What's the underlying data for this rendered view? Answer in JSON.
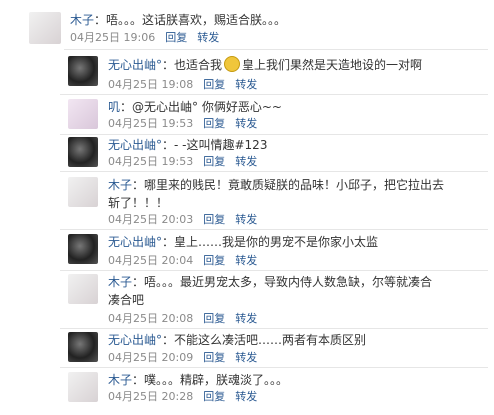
{
  "comments": [
    {
      "name": "木子",
      "avatar": "muzi-avatar",
      "text": "：唔。。。这话朕喜欢，赐适合朕。。。",
      "time": "04月25日 19:06",
      "reply": "回复",
      "forward": "转发"
    },
    {
      "name": "无心出岫°",
      "avatar": "wuxin-avatar",
      "text_before": "：也适合我",
      "emoji": "smiley-icon",
      "text_after": "皇上我们果然是天造地设的一对啊",
      "time": "04月25日 19:08",
      "reply": "回复",
      "forward": "转发"
    },
    {
      "name": "叽",
      "avatar": "ji-avatar",
      "text": "：@无心出岫° 你俩好恶心~~",
      "time": "04月25日 19:53",
      "reply": "回复",
      "forward": "转发"
    },
    {
      "name": "无心出岫°",
      "avatar": "wuxin-avatar",
      "text": "：- -这叫情趣#123",
      "time": "04月25日 19:53",
      "reply": "回复",
      "forward": "转发"
    },
    {
      "name": "木子",
      "avatar": "muzi-avatar",
      "text_line1": "：哪里来的贱民！竟敢质疑朕的品味！小邱子，把它拉出去",
      "text_line2": "斩了！！！",
      "time": "04月25日 20:03",
      "reply": "回复",
      "forward": "转发"
    },
    {
      "name": "无心出岫°",
      "avatar": "wuxin-avatar",
      "text": "：皇上……我是你的男宠不是你家小太监",
      "time": "04月25日 20:04",
      "reply": "回复",
      "forward": "转发"
    },
    {
      "name": "木子",
      "avatar": "muzi-avatar",
      "text_line1": "：唔。。。最近男宠太多，导致内侍人数急缺，尔等就凑合",
      "text_line2": "凑合吧",
      "time": "04月25日 20:08",
      "reply": "回复",
      "forward": "转发"
    },
    {
      "name": "无心出岫°",
      "avatar": "wuxin-avatar",
      "text": "：不能这么凑活吧……两者有本质区别",
      "time": "04月25日 20:09",
      "reply": "回复",
      "forward": "转发"
    },
    {
      "name": "木子",
      "avatar": "muzi-avatar",
      "text": "：噗。。。精辟，朕魂淡了。。。",
      "time": "04月25日 20:28",
      "reply": "回复",
      "forward": "转发"
    }
  ]
}
